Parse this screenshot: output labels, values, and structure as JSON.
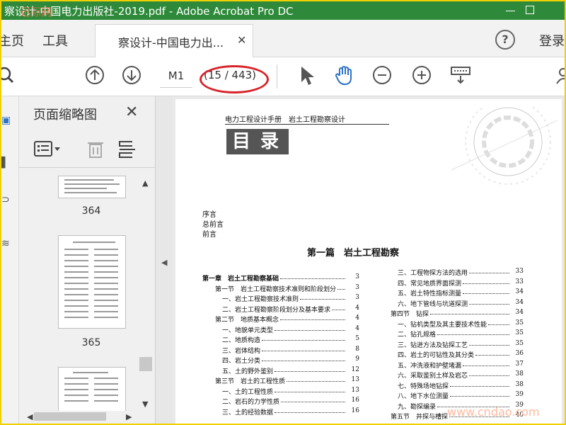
{
  "window": {
    "title": "察设计-中国电力出版社-2019.pdf - Adobe Acrobat Pro DC",
    "watermark_top": "迅际网"
  },
  "tabs": {
    "home": "主页",
    "tools": "工具",
    "doc": "察设计-中国电力出...",
    "help": "?",
    "login": "登录"
  },
  "toolbar": {
    "page_input": "M1",
    "page_count": "(15 / 443)"
  },
  "thumbnails": {
    "title": "页面缩略图",
    "labels": [
      "364",
      "365"
    ]
  },
  "page": {
    "header": "电力工程设计手册　岩土工程勘察设计",
    "contents_title": "目录",
    "preface": [
      "序言",
      "总前言",
      "前言"
    ],
    "part_title": "第一篇　岩土工程勘察",
    "left_entries": [
      {
        "text": "第一章　岩土工程勘察基础",
        "page": "3",
        "level": 0
      },
      {
        "text": "第一节　岩土工程勘察技术准则和阶段划分",
        "page": "3",
        "level": 1
      },
      {
        "text": "一、岩土工程勘察技术准则",
        "page": "3",
        "level": 2
      },
      {
        "text": "二、岩土工程勘察阶段划分及基本要求",
        "page": "4",
        "level": 2
      },
      {
        "text": "第二节　地质基本概念",
        "page": "4",
        "level": 1
      },
      {
        "text": "一、地貌单元类型",
        "page": "4",
        "level": 2
      },
      {
        "text": "二、地质构造",
        "page": "5",
        "level": 2
      },
      {
        "text": "三、岩体结构",
        "page": "8",
        "level": 2
      },
      {
        "text": "四、岩土分类",
        "page": "9",
        "level": 2
      },
      {
        "text": "五、土的野外鉴别",
        "page": "12",
        "level": 2
      },
      {
        "text": "第三节　岩土的工程性质",
        "page": "13",
        "level": 1
      },
      {
        "text": "一、土的工程性质",
        "page": "13",
        "level": 2
      },
      {
        "text": "二、岩石的力学性质",
        "page": "16",
        "level": 2
      },
      {
        "text": "三、土的经验数据",
        "page": "16",
        "level": 2
      }
    ],
    "right_entries": [
      {
        "text": "三、工程物探方法的选用",
        "page": "33",
        "level": 2
      },
      {
        "text": "四、常见地质界面探测",
        "page": "33",
        "level": 2
      },
      {
        "text": "五、岩土特性指标测量",
        "page": "34",
        "level": 2
      },
      {
        "text": "六、地下管线与坑道探测",
        "page": "34",
        "level": 2
      },
      {
        "text": "第四节　钻探",
        "page": "34",
        "level": 1
      },
      {
        "text": "一、钻机类型及其主要技术性能",
        "page": "35",
        "level": 2
      },
      {
        "text": "二、钻孔规格",
        "page": "35",
        "level": 2
      },
      {
        "text": "三、钻进方法及钻探工艺",
        "page": "35",
        "level": 2
      },
      {
        "text": "四、岩土的可钻性及其分类",
        "page": "36",
        "level": 2
      },
      {
        "text": "五、冲洗液和护壁堵漏",
        "page": "37",
        "level": 2
      },
      {
        "text": "六、采取鉴别土样及岩芯",
        "page": "38",
        "level": 2
      },
      {
        "text": "七、特殊场地钻探",
        "page": "38",
        "level": 2
      },
      {
        "text": "八、地下水位测量",
        "page": "39",
        "level": 2
      },
      {
        "text": "九、勘探编录",
        "page": "39",
        "level": 2
      },
      {
        "text": "第五节　井探与槽探",
        "page": "40",
        "level": 1
      }
    ]
  },
  "watermark_bottom": "www.cndao.com",
  "colors": {
    "titlebar": "#2e8a3a",
    "accent": "#2d73c7",
    "annotation": "#d8242b"
  }
}
